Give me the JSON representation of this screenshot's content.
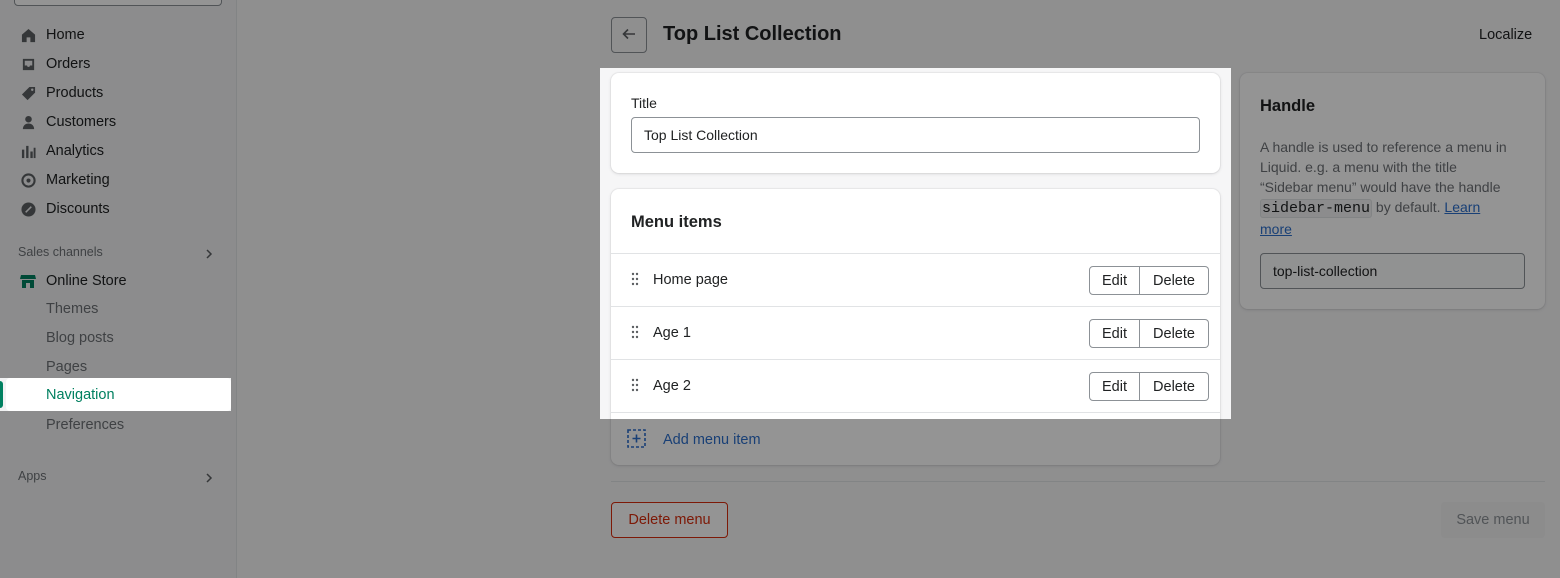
{
  "sidebar": {
    "main_items": [
      {
        "label": "Home",
        "icon": "home-icon"
      },
      {
        "label": "Orders",
        "icon": "orders-icon"
      },
      {
        "label": "Products",
        "icon": "tag-icon"
      },
      {
        "label": "Customers",
        "icon": "person-icon"
      },
      {
        "label": "Analytics",
        "icon": "bar-chart-icon"
      },
      {
        "label": "Marketing",
        "icon": "target-icon"
      },
      {
        "label": "Discounts",
        "icon": "discount-icon"
      }
    ],
    "sales_channels_heading": "Sales channels",
    "online_store": {
      "label": "Online Store",
      "icon": "store-icon"
    },
    "sub_items": [
      {
        "label": "Themes"
      },
      {
        "label": "Blog posts"
      },
      {
        "label": "Pages"
      },
      {
        "label": "Navigation",
        "selected": true
      },
      {
        "label": "Preferences"
      }
    ],
    "apps_heading": "Apps"
  },
  "header": {
    "title": "Top List Collection",
    "localize_label": "Localize"
  },
  "title_card": {
    "field_label": "Title",
    "field_value": "Top List Collection"
  },
  "menu_card": {
    "heading": "Menu items",
    "rows": [
      {
        "label": "Home page",
        "edit_label": "Edit",
        "delete_label": "Delete"
      },
      {
        "label": "Age 1",
        "edit_label": "Edit",
        "delete_label": "Delete"
      },
      {
        "label": "Age 2",
        "edit_label": "Edit",
        "delete_label": "Delete"
      }
    ],
    "add_label": "Add menu item"
  },
  "handle_card": {
    "heading": "Handle",
    "help_pre": "A handle is used to reference a menu in Liquid. e.g. a menu with the title “Sidebar menu” would have the handle ",
    "help_code": "sidebar-menu",
    "help_post": " by default. ",
    "help_link": "Learn more",
    "field_value": "top-list-collection"
  },
  "footer": {
    "delete_label": "Delete menu",
    "save_label": "Save menu"
  },
  "colors": {
    "accent": "#008060",
    "link": "#2c6ecb",
    "critical": "#d72c0d"
  }
}
